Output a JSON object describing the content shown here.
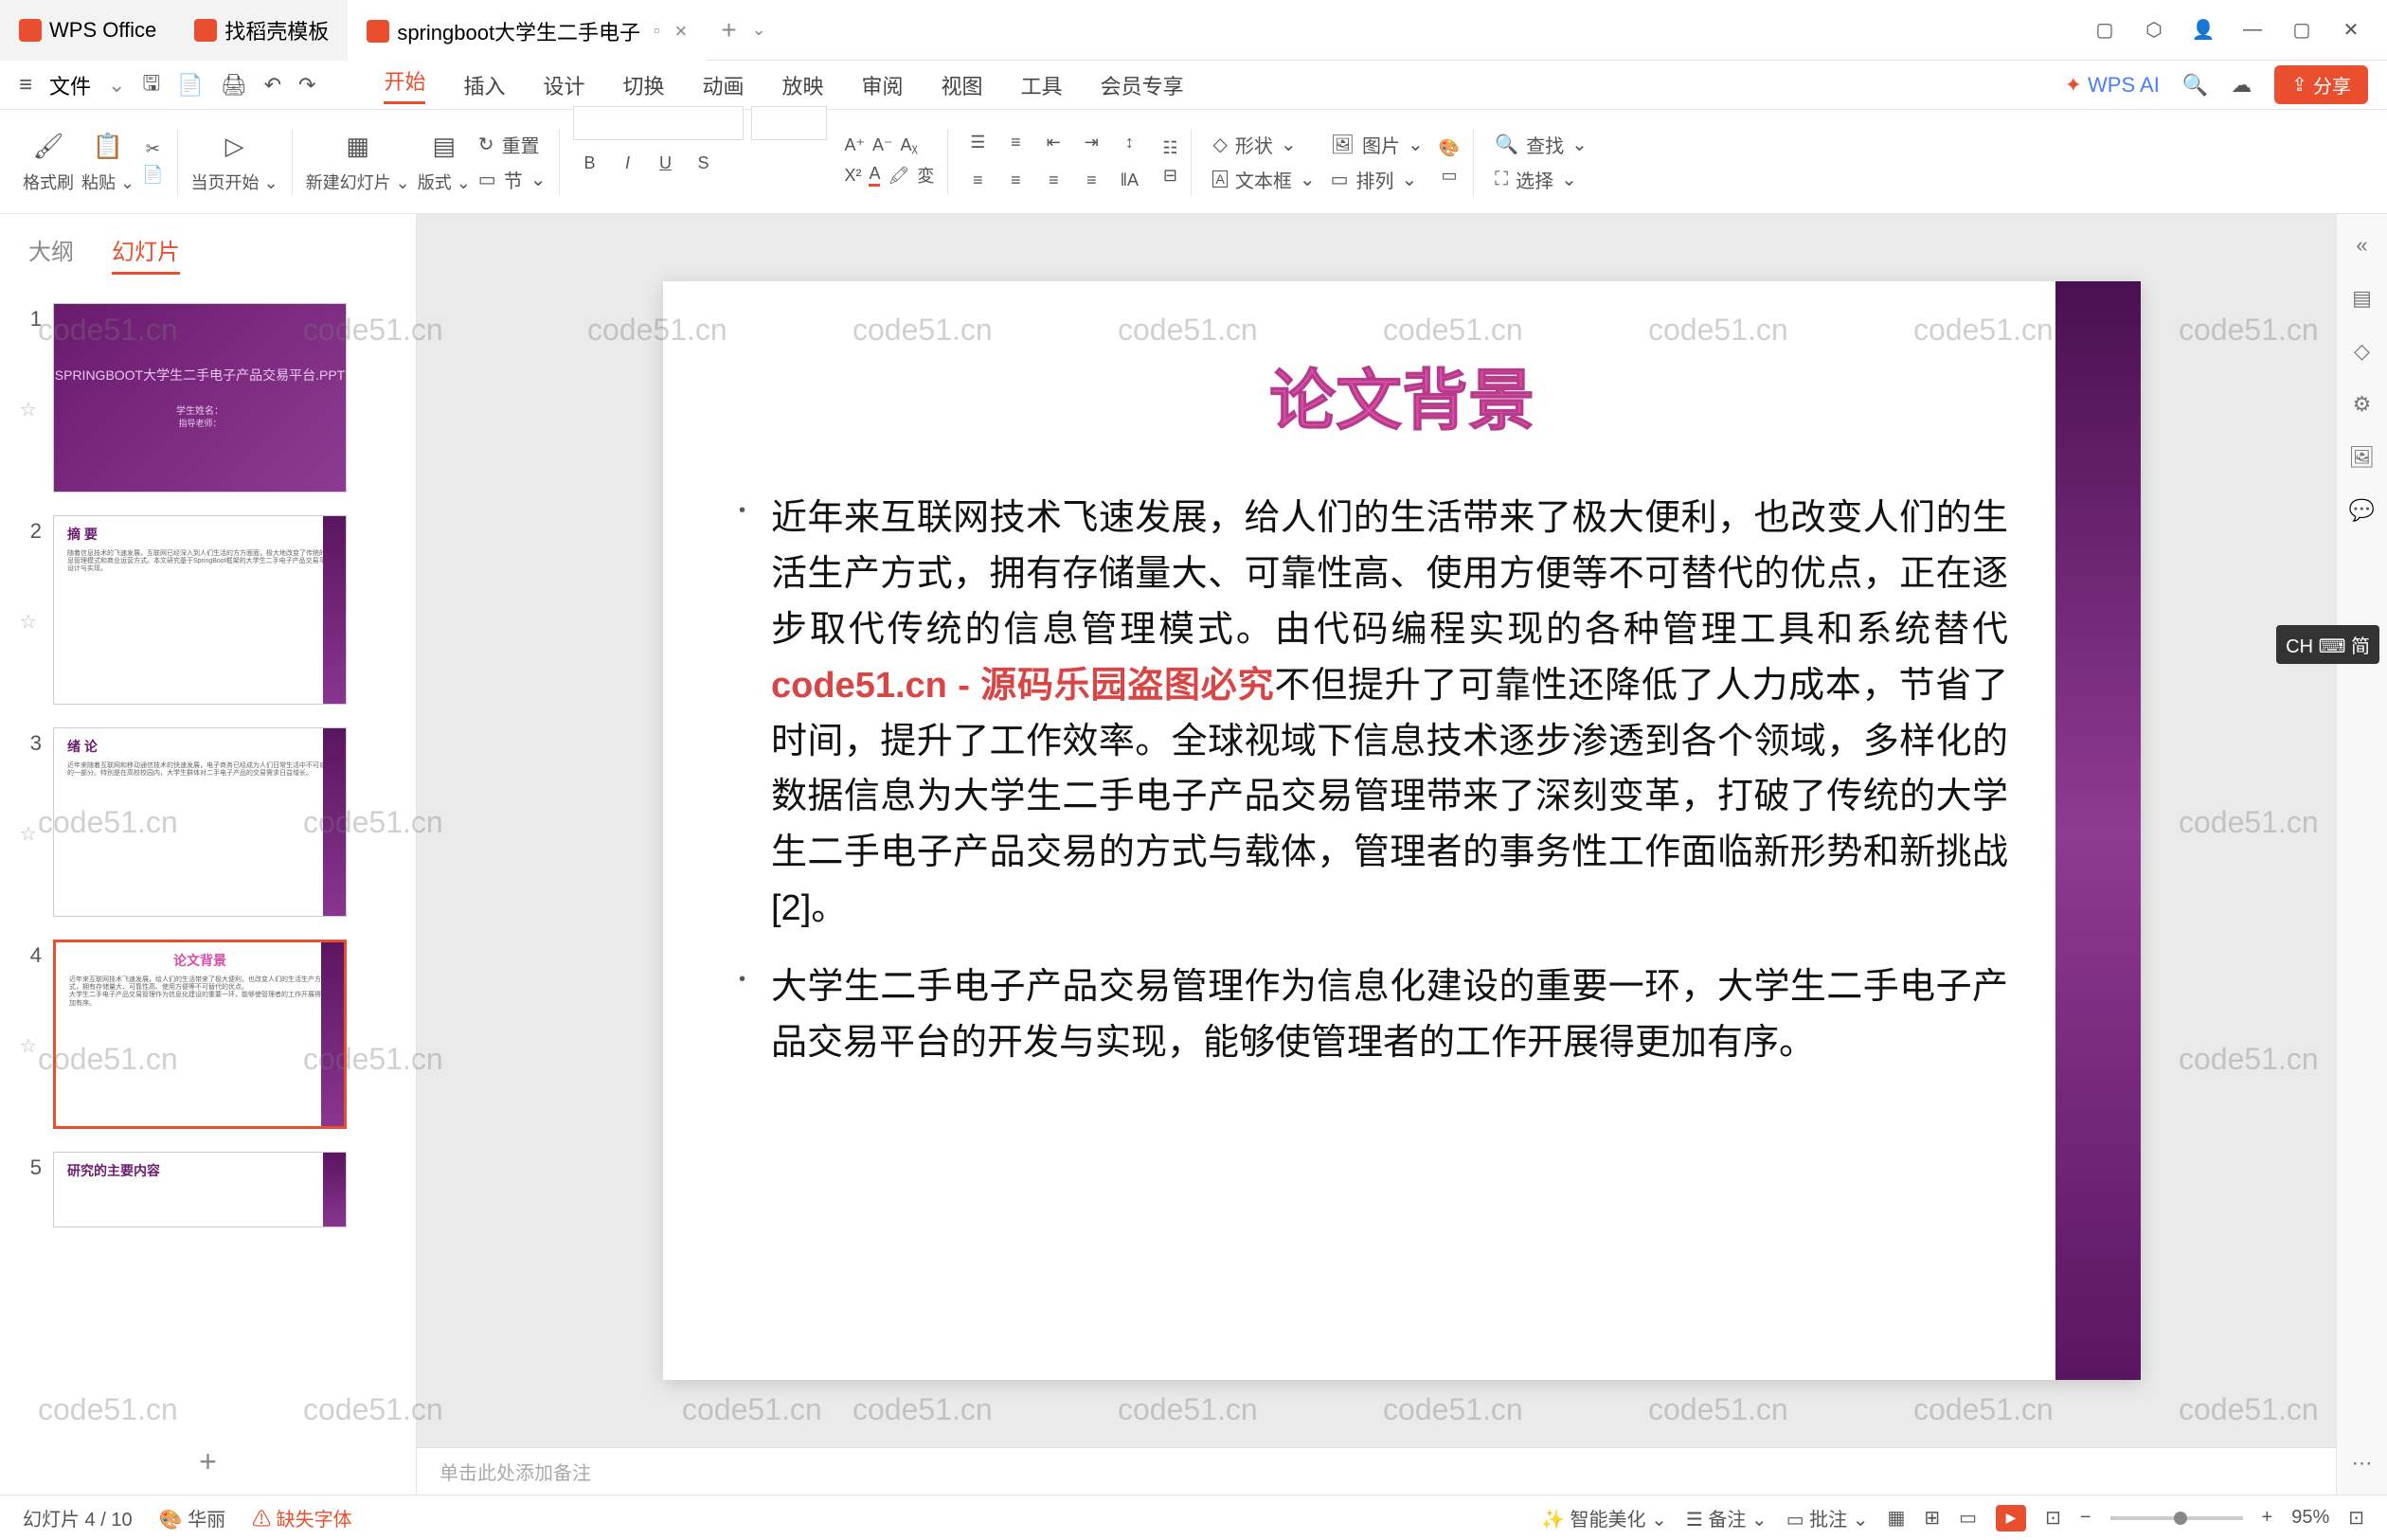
{
  "titlebar": {
    "app_name": "WPS Office",
    "tab2": "找稻壳模板",
    "tab3": "springboot大学生二手电子",
    "plus": "+"
  },
  "menubar": {
    "file": "文件",
    "items": [
      "开始",
      "插入",
      "设计",
      "切换",
      "动画",
      "放映",
      "审阅",
      "视图",
      "工具",
      "会员专享"
    ],
    "wps_ai": "WPS AI",
    "share": "分享"
  },
  "ribbon": {
    "format_brush": "格式刷",
    "paste": "粘贴",
    "from_current": "当页开始",
    "new_slide": "新建幻灯片",
    "layout": "版式",
    "section": "节",
    "reset": "重置",
    "shape": "形状",
    "picture": "图片",
    "textbox": "文本框",
    "arrange": "排列",
    "find": "查找",
    "select": "选择"
  },
  "side": {
    "tab_outline": "大纲",
    "tab_slides": "幻灯片",
    "thumbs": [
      {
        "num": "1",
        "title": "SPRINGBOOT大学生二手电子产品交易平台.PPT",
        "sub1": "学生姓名：",
        "sub2": "指导老师："
      },
      {
        "num": "2",
        "title": "摘 要"
      },
      {
        "num": "3",
        "title": "绪 论"
      },
      {
        "num": "4",
        "title": "论文背景"
      },
      {
        "num": "5",
        "title": "研究的主要内容"
      }
    ],
    "add": "+"
  },
  "slide": {
    "title": "论文背景",
    "para1_a": "近年来互联网技术飞速发展，给人们的生活带来了极大便利，也改变人们的生活生产方式，拥有存储量大、可靠性高、使用方便等不可替代的优点，正在逐步取代传统的信息管理模式。由代码编程实现的各种管理工具和系统替代",
    "para1_red": "code51.cn - 源码乐园盗图必究",
    "para1_b": "不但提升了可靠性还降低了人力成本，节省了时间，提升了工作效率。全球视域下信息技术逐步渗透到各个领域，多样化的数据信息为大学生二手电子产品交易管理带来了深刻变革，打破了传统的大学生二手电子产品交易的方式与载体，管理者的事务性工作面临新形势和新挑战[2]。",
    "para2": "大学生二手电子产品交易管理作为信息化建设的重要一环，大学生二手电子产品交易平台的开发与实现，能够使管理者的工作开展得更加有序。"
  },
  "notes": {
    "placeholder": "单击此处添加备注"
  },
  "statusbar": {
    "slide_indicator": "幻灯片 4 / 10",
    "theme": "华丽",
    "missing_font": "缺失字体",
    "smart_beautify": "智能美化",
    "remarks": "备注",
    "review": "批注",
    "zoom": "95%"
  },
  "watermark": "code51.cn",
  "ime": "CH ⌨ 简"
}
